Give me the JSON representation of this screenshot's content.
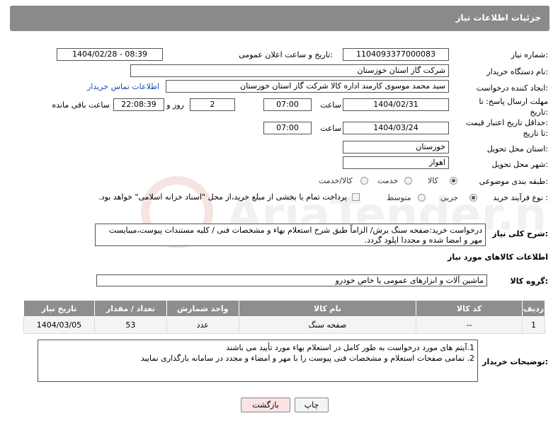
{
  "header": {
    "title": "جزئیات اطلاعات نیاز"
  },
  "fields": {
    "need_number_label": "شماره نیاز:",
    "need_number": "1104093377000083",
    "announce_label": "تاریخ و ساعت اعلان عمومی:",
    "announce_value": "1404/02/28 - 08:39",
    "buyer_org_label": "نام دستگاه خریدار:",
    "buyer_org": "شرکت گاز استان خوزستان",
    "requester_label": "ایجاد کننده درخواست:",
    "requester": "سید محمد موسوی کارمند اداره کالا شرکت گاز استان خوزستان",
    "contact_link": "اطلاعات تماس خریدار",
    "deadline_label_1": "مهلت ارسال پاسخ: تا",
    "deadline_label_2": "تاریخ:",
    "deadline_date": "1404/02/31",
    "time_label": "ساعت",
    "deadline_time": "07:00",
    "days_count": "2",
    "days_label": "روز و",
    "remaining_time": "22:08:39",
    "remaining_label": "ساعت باقی مانده",
    "min_price_label_1": "حداقل تاریخ اعتبار قیمت:",
    "min_price_label_2": "تا تاریخ:",
    "min_price_date": "1404/03/24",
    "min_price_time": "07:00",
    "province_label": "استان محل تحویل:",
    "province": "خوزستان",
    "city_label": "شهر محل تحویل:",
    "city": "اهواز",
    "category_label": "طبقه بندی موضوعی:",
    "category_options": [
      "کالا",
      "خدمت",
      "کالا/خدمت"
    ],
    "process_label": "نوع فرآیند خرید :",
    "process_options": [
      "جزیی",
      "متوسط"
    ],
    "payment_note": "پرداخت تمام یا بخشی از مبلغ خرید،از محل \"اسناد خزانه اسلامی\" خواهد بود."
  },
  "description": {
    "label": "شرح کلی نیاز:",
    "text": "درخواست خرید:صفحه سنگ برش/ الزاماً طبق شرح استعلام بهاء و مشخصات فنی / کلیه مستندات پیوست،میبایست مهر و امضا شده و مجددا اپلود گردد."
  },
  "goods": {
    "section_title": "اطلاعات کالاهای مورد نیاز",
    "group_label": "گروه کالا:",
    "group_value": "ماشین آلات و ابزارهای عمومی یا خاص خودرو",
    "columns": [
      "ردیف",
      "کد کالا",
      "نام کالا",
      "واحد شمارش",
      "تعداد / مقدار",
      "تاریخ نیاز"
    ],
    "rows": [
      {
        "row": "1",
        "code": "--",
        "name": "صفحه سنگ",
        "unit": "عدد",
        "qty": "53",
        "date": "1404/03/05"
      }
    ]
  },
  "buyer_notes": {
    "label": "توضیحات خریدار:",
    "line1": "1.آیتم های مورد درخواست به طور کامل در استعلام بهاء مورد تأیید می باشند",
    "line2": "2. تمامی صفحات استعلام و مشخصات فنی پیوست را با مهر و امضاء و مجدد در سامانه بارگذاری نمایید"
  },
  "buttons": {
    "print": "چاپ",
    "back": "بازگشت"
  },
  "watermark": {
    "text": "AriaTender.net"
  },
  "colors": {
    "header_bg": "#8a8a8a",
    "link": "#1a4fb0",
    "back_button_bg": "#fbe3e4"
  }
}
